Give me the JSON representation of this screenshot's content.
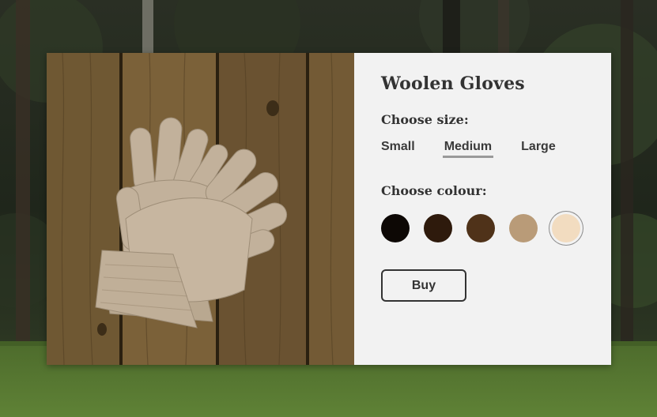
{
  "product": {
    "title": "Woolen Gloves",
    "image_alt": "knitted woolen gloves on wooden planks"
  },
  "size": {
    "label": "Choose size:",
    "options": [
      "Small",
      "Medium",
      "Large"
    ],
    "selected": "Medium"
  },
  "colour": {
    "label": "Choose colour:",
    "swatches": [
      "#0d0805",
      "#2e1a0c",
      "#4f3219",
      "#b99b78",
      "#f2dcc0"
    ],
    "selected_index": 4
  },
  "buy": {
    "label": "Buy"
  }
}
